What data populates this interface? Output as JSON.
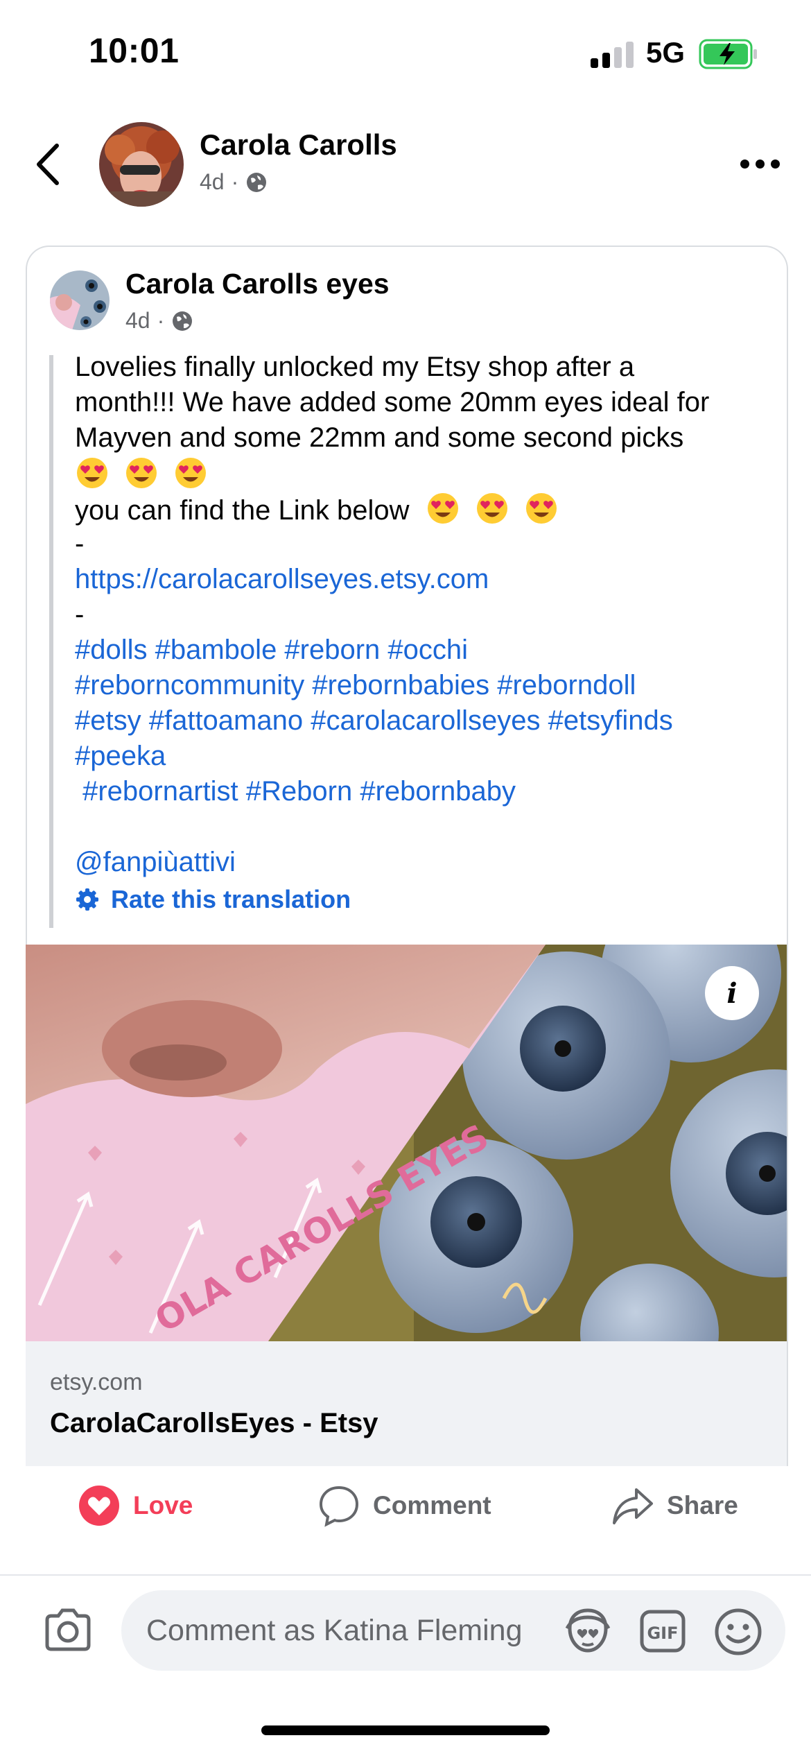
{
  "status_bar": {
    "time": "10:01",
    "network": "5G",
    "battery_state": "charging"
  },
  "header": {
    "author": "Carola Carolls",
    "time_ago": "4d",
    "privacy_icon": "globe-icon"
  },
  "shared_post": {
    "author": "Carola Carolls eyes",
    "time_ago": "4d",
    "lines": [
      "Lovelies finally unlocked my Etsy shop after a",
      "month!!! We have added some 20mm eyes ideal for",
      "Mayven and some 22mm and some second picks",
      "",
      "you can find the Link below",
      "-",
      "https://carolacarollseyes.etsy.com",
      "-",
      "#dolls #bambole #reborn #occhi",
      "#reborncommunity #rebornbabies #reborndoll",
      "#etsy #fattoamano #carolacarollseyes #etsyfinds",
      "#peeka",
      " #rebornartist #Reborn #rebornbaby",
      "",
      "@fanpiùattivi"
    ],
    "emoji": "heart-eyes-emoji",
    "rate_translation": "Rate this translation"
  },
  "link_preview": {
    "image_text": "OLA CAROLLS EYES",
    "domain": "etsy.com",
    "title": "CarolaCarollsEyes - Etsy"
  },
  "actions": {
    "love": "Love",
    "comment": "Comment",
    "share": "Share"
  },
  "comment_bar": {
    "placeholder": "Comment as Katina Fleming"
  },
  "colors": {
    "link": "#1a66d6",
    "love": "#f33e58",
    "muted": "#65676b",
    "battery": "#34c759"
  }
}
